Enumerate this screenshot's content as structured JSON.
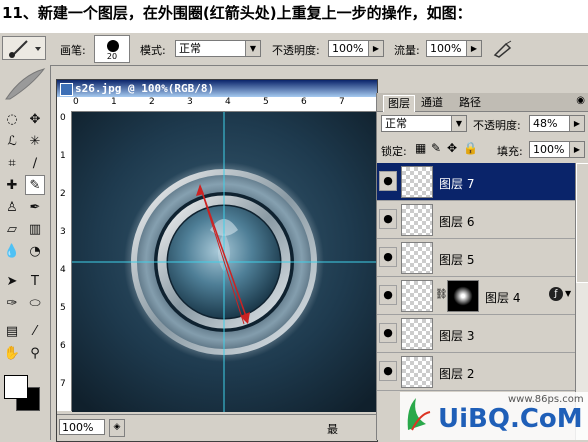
{
  "caption": "11、新建一个图层，在外围圈(红箭头处)上重复上一步的操作，如图：",
  "options": {
    "brush_label": "画笔:",
    "brush_size": "20",
    "mode_label": "模式:",
    "mode_value": "正常",
    "opacity_label": "不透明度:",
    "opacity_value": "100%",
    "flow_label": "流量:",
    "flow_value": "100%"
  },
  "document": {
    "title": "s26.jpg @ 100%(RGB/8)",
    "zoom": "100%",
    "ruler_h": [
      "0",
      "1",
      "2",
      "3",
      "4",
      "5",
      "6",
      "7"
    ],
    "ruler_v": [
      "0",
      "1",
      "2",
      "3",
      "4",
      "5",
      "6",
      "7"
    ],
    "status_partial": "最"
  },
  "layers": {
    "tabs": [
      "图层",
      "通道",
      "路径"
    ],
    "blend_mode": "正常",
    "opacity_label": "不透明度:",
    "opacity_value": "48%",
    "lock_label": "锁定:",
    "fill_label": "填充:",
    "fill_value": "100%",
    "items": [
      {
        "name": "图层 7"
      },
      {
        "name": "图层 6"
      },
      {
        "name": "图层 5"
      },
      {
        "name": "图层 4"
      },
      {
        "name": "图层 3"
      },
      {
        "name": "图层 2"
      }
    ]
  },
  "watermark": {
    "site": "www.86ps.com",
    "brand": "UiBQ.CoM"
  },
  "colors": {
    "selected_layer": "#0a246a",
    "guide": "#3fd0e8",
    "arrow": "#cc2222"
  }
}
